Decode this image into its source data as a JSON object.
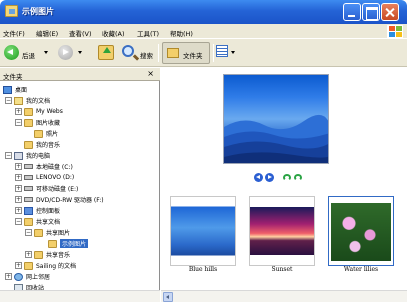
{
  "window": {
    "title": "示例图片"
  },
  "menu": [
    "文件(F)",
    "编辑(E)",
    "查看(V)",
    "收藏(A)",
    "工具(T)",
    "帮助(H)"
  ],
  "toolbar": {
    "back_label": "后退",
    "search_label": "搜索",
    "folders_label": "文件夹"
  },
  "folder_pane": {
    "header": "文件夹",
    "close_glyph": "×",
    "tree": [
      {
        "label": "桌面",
        "icon": "desktop-icon"
      },
      {
        "label": "我的文档",
        "icon": "my-documents-icon"
      },
      {
        "label": "My Webs",
        "icon": "folder-icon"
      },
      {
        "label": "图片收藏",
        "icon": "folder-icon"
      },
      {
        "label": "照片",
        "icon": "folder-icon"
      },
      {
        "label": "我的音乐",
        "icon": "folder-icon"
      },
      {
        "label": "我的电脑",
        "icon": "my-computer-icon"
      },
      {
        "label": "本地磁盘 (C:)",
        "icon": "drive-icon"
      },
      {
        "label": "LENOVO (D:)",
        "icon": "drive-icon"
      },
      {
        "label": "可移动磁盘 (E:)",
        "icon": "drive-icon"
      },
      {
        "label": "DVD/CD-RW 驱动器 (F:)",
        "icon": "dvd-icon"
      },
      {
        "label": "控制面板",
        "icon": "control-panel-icon"
      },
      {
        "label": "共享文档",
        "icon": "folder-icon"
      },
      {
        "label": "共享图片",
        "icon": "folder-icon"
      },
      {
        "label": "示例图片",
        "icon": "folder-icon",
        "selected": true
      },
      {
        "label": "共享音乐",
        "icon": "folder-icon"
      },
      {
        "label": "Sailing 的文档",
        "icon": "folder-icon"
      },
      {
        "label": "网上邻居",
        "icon": "network-icon"
      },
      {
        "label": "回收站",
        "icon": "recycle-bin-icon"
      }
    ]
  },
  "thumbnails": [
    {
      "label": "Blue hills"
    },
    {
      "label": "Sunset"
    },
    {
      "label": "Water lilies"
    }
  ]
}
